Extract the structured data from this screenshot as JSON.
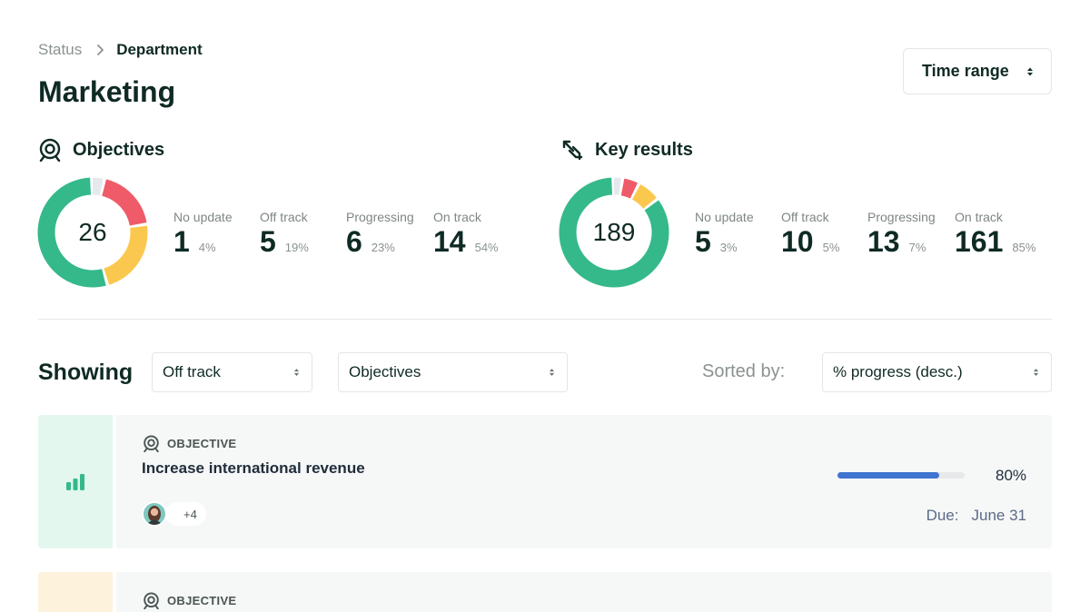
{
  "breadcrumb": {
    "parent": "Status",
    "current": "Department"
  },
  "page_title": "Marketing",
  "time_range_label": "Time range",
  "colors": {
    "no_update": "#e6e9ec",
    "off_track": "#ef5b68",
    "progressing": "#fbc84f",
    "on_track": "#35b98a",
    "progress_bar": "#3f74d0"
  },
  "objectives": {
    "title": "Objectives",
    "total": "26",
    "stats": [
      {
        "label": "No update",
        "value": "1",
        "pct": "4%",
        "fraction": 0.04
      },
      {
        "label": "Off track",
        "value": "5",
        "pct": "19%",
        "fraction": 0.19
      },
      {
        "label": "Progressing",
        "value": "6",
        "pct": "23%",
        "fraction": 0.23
      },
      {
        "label": "On track",
        "value": "14",
        "pct": "54%",
        "fraction": 0.54
      }
    ]
  },
  "key_results": {
    "title": "Key results",
    "total": "189",
    "stats": [
      {
        "label": "No update",
        "value": "5",
        "pct": "3%",
        "fraction": 0.03
      },
      {
        "label": "Off track",
        "value": "10",
        "pct": "5%",
        "fraction": 0.05
      },
      {
        "label": "Progressing",
        "value": "13",
        "pct": "7%",
        "fraction": 0.07
      },
      {
        "label": "On track",
        "value": "161",
        "pct": "85%",
        "fraction": 0.85
      }
    ]
  },
  "filters": {
    "showing_label": "Showing",
    "status_value": "Off track",
    "type_value": "Objectives",
    "sorted_label": "Sorted by:",
    "sort_value": "% progress (desc.)"
  },
  "cards": [
    {
      "type_label": "OBJECTIVE",
      "title": "Increase international revenue",
      "extra_owners": "+4",
      "progress_pct": "80%",
      "progress_fraction": 0.8,
      "due_label": "Due:",
      "due_date": "June 31",
      "side_color": "#e4f7ef"
    },
    {
      "type_label": "OBJECTIVE",
      "side_color": "#fdf2dc"
    }
  ]
}
